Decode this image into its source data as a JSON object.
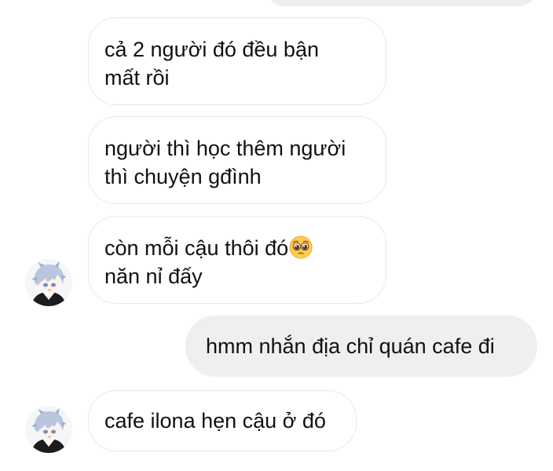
{
  "messages": [
    {
      "from": "them",
      "lines": [
        "cả 2 người đó đều bận",
        "mất rồi"
      ]
    },
    {
      "from": "them",
      "lines": [
        "người thì học thêm người",
        "thì chuyện gđình"
      ]
    },
    {
      "from": "them",
      "lines": [
        "còn mỗi cậu thôi đó",
        "năn nỉ đấy"
      ],
      "emoji": "pleading-face"
    },
    {
      "from": "me",
      "lines": [
        "hmm nhắn địa chỉ quán cafe đi"
      ]
    },
    {
      "from": "them",
      "lines": [
        "cafe ilona hẹn cậu ở đó"
      ]
    }
  ],
  "colors": {
    "incoming_bubble_border": "#e9e9e9",
    "outgoing_bubble_bg": "#efefef",
    "text": "#111111"
  }
}
